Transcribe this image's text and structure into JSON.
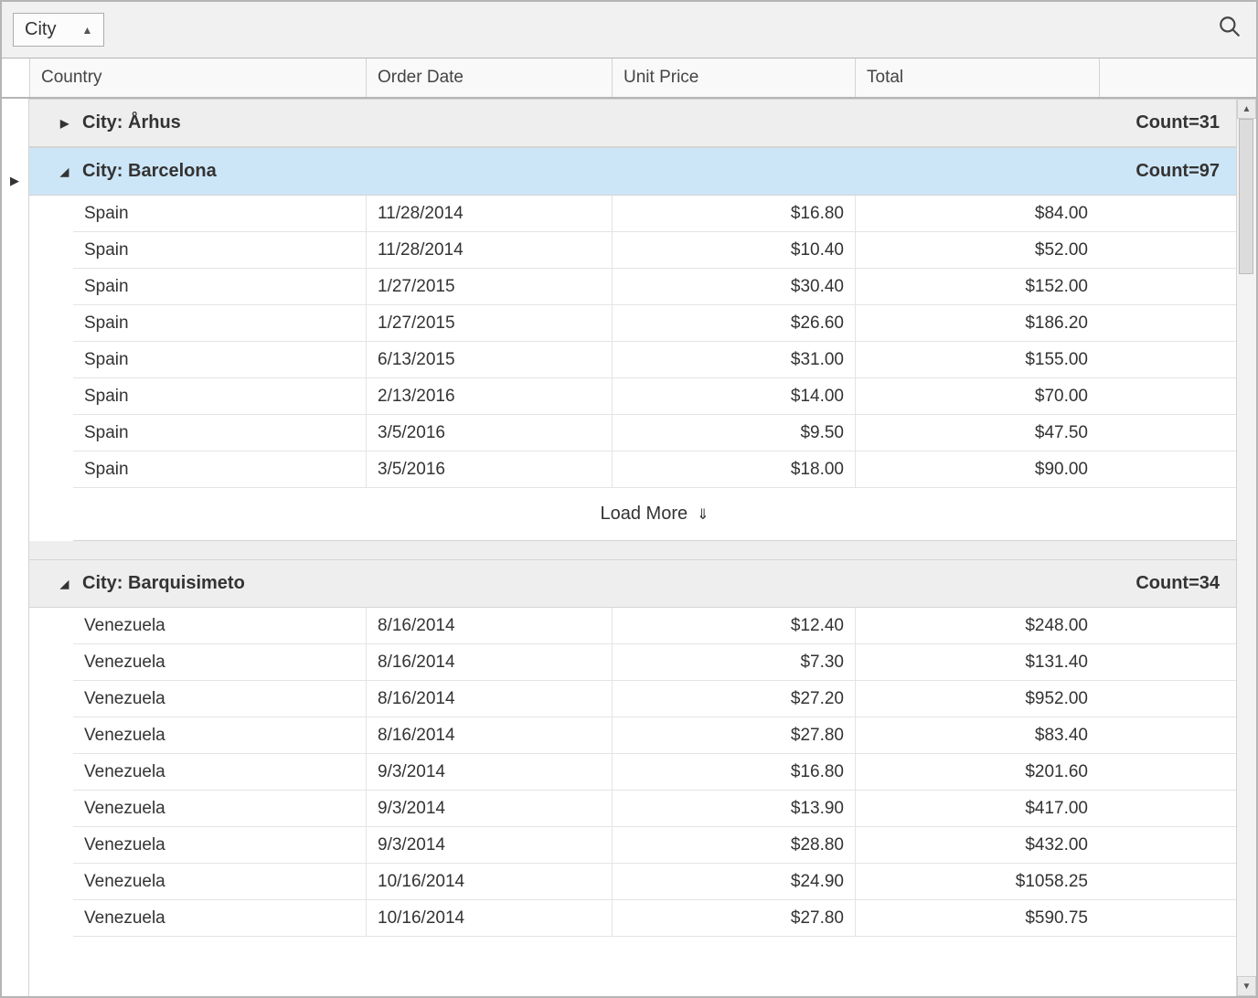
{
  "toolbar": {
    "group_chip_label": "City"
  },
  "columns": {
    "country": "Country",
    "order_date": "Order Date",
    "unit_price": "Unit Price",
    "total": "Total"
  },
  "groups": [
    {
      "expanded": false,
      "label_prefix": "City:",
      "city": "Århus",
      "count_label": "Count=31",
      "full_label": "City: Århus",
      "selected": false,
      "rows": []
    },
    {
      "expanded": true,
      "label_prefix": "City:",
      "city": "Barcelona",
      "count_label": "Count=97",
      "full_label": "City: Barcelona",
      "selected": true,
      "load_more": true,
      "load_more_label": "Load More",
      "rows": [
        {
          "country": "Spain",
          "date": "11/28/2014",
          "price": "$16.80",
          "total": "$84.00"
        },
        {
          "country": "Spain",
          "date": "11/28/2014",
          "price": "$10.40",
          "total": "$52.00"
        },
        {
          "country": "Spain",
          "date": "1/27/2015",
          "price": "$30.40",
          "total": "$152.00"
        },
        {
          "country": "Spain",
          "date": "1/27/2015",
          "price": "$26.60",
          "total": "$186.20"
        },
        {
          "country": "Spain",
          "date": "6/13/2015",
          "price": "$31.00",
          "total": "$155.00"
        },
        {
          "country": "Spain",
          "date": "2/13/2016",
          "price": "$14.00",
          "total": "$70.00"
        },
        {
          "country": "Spain",
          "date": "3/5/2016",
          "price": "$9.50",
          "total": "$47.50"
        },
        {
          "country": "Spain",
          "date": "3/5/2016",
          "price": "$18.00",
          "total": "$90.00"
        }
      ]
    },
    {
      "expanded": true,
      "label_prefix": "City:",
      "city": "Barquisimeto",
      "count_label": "Count=34",
      "full_label": "City: Barquisimeto",
      "selected": false,
      "load_more": false,
      "rows": [
        {
          "country": "Venezuela",
          "date": "8/16/2014",
          "price": "$12.40",
          "total": "$248.00"
        },
        {
          "country": "Venezuela",
          "date": "8/16/2014",
          "price": "$7.30",
          "total": "$131.40"
        },
        {
          "country": "Venezuela",
          "date": "8/16/2014",
          "price": "$27.20",
          "total": "$952.00"
        },
        {
          "country": "Venezuela",
          "date": "8/16/2014",
          "price": "$27.80",
          "total": "$83.40"
        },
        {
          "country": "Venezuela",
          "date": "9/3/2014",
          "price": "$16.80",
          "total": "$201.60"
        },
        {
          "country": "Venezuela",
          "date": "9/3/2014",
          "price": "$13.90",
          "total": "$417.00"
        },
        {
          "country": "Venezuela",
          "date": "9/3/2014",
          "price": "$28.80",
          "total": "$432.00"
        },
        {
          "country": "Venezuela",
          "date": "10/16/2014",
          "price": "$24.90",
          "total": "$1058.25"
        },
        {
          "country": "Venezuela",
          "date": "10/16/2014",
          "price": "$27.80",
          "total": "$590.75"
        }
      ]
    }
  ]
}
